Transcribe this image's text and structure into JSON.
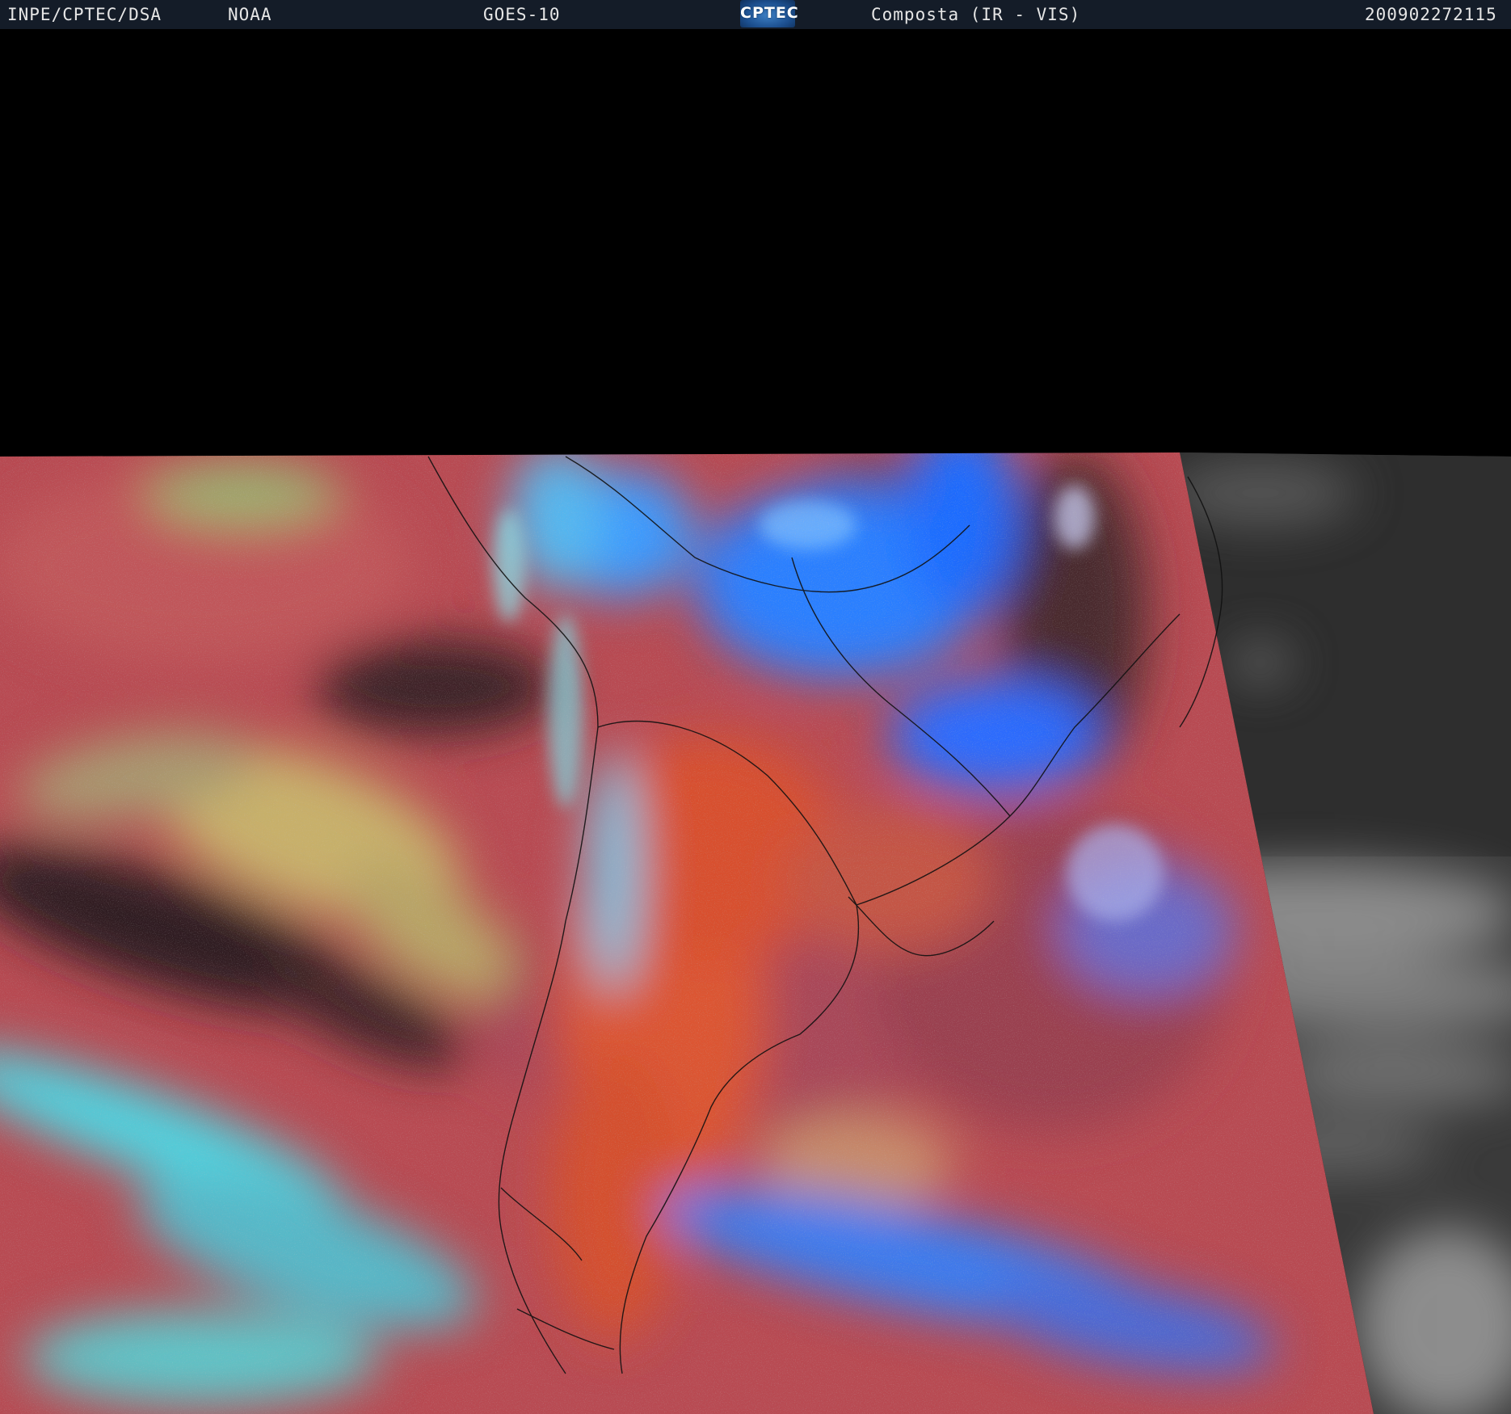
{
  "header": {
    "agency": "INPE/CPTEC/DSA",
    "provider": "NOAA",
    "satellite": "GOES-10",
    "logo_text": "CPTEC",
    "product": "Composta (IR - VIS)",
    "timestamp": "200902272115"
  },
  "colors": {
    "header_bg": "#141c28",
    "header_text": "#e6e6e6",
    "clear_land": "#d9502e",
    "ocean_red": "#b84a52",
    "cold_cloud_blue": "#2a7fff",
    "low_cloud_cyan": "#4fd3e0",
    "mid_cloud_yellow": "#c8b06a",
    "visible_gray": "#4a4a4a"
  }
}
